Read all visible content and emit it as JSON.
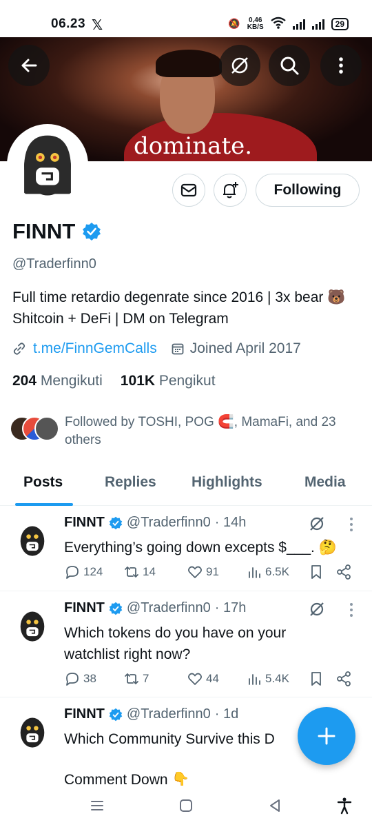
{
  "status_bar": {
    "time": "06.23",
    "app_icon": "x-logo",
    "net_speed_value": "0,46",
    "net_speed_unit": "KB/S",
    "battery": "29"
  },
  "header": {
    "banner_caption": "dominate.",
    "back_icon": "back-arrow-icon",
    "grok_icon": "grok-icon",
    "search_icon": "search-icon",
    "more_icon": "more-vertical-icon"
  },
  "profile": {
    "name": "FINNT",
    "handle": "@Traderfinn0",
    "bio": "Full time retardio degenrate since 2016 | 3x bear 🐻 Shitcoin + DeFi | DM on Telegram",
    "link": "t.me/FinnGemCalls",
    "joined": "Joined April 2017",
    "following_count": "204",
    "following_label": "Mengikuti",
    "followers_count": "101K",
    "followers_label": "Pengikut",
    "followed_by": "Followed by TOSHI, POG 🧲, MamaFi, and 23 others",
    "following_button": "Following",
    "accent": "#1d9bf0"
  },
  "tabs": [
    {
      "label": "Posts",
      "active": true
    },
    {
      "label": "Replies",
      "active": false
    },
    {
      "label": "Highlights",
      "active": false
    },
    {
      "label": "Media",
      "active": false
    }
  ],
  "tweets": [
    {
      "name": "FINNT",
      "handle": "@Traderfinn0",
      "time": "· 14h",
      "text": "Everything’s going down excepts $___. 🤔",
      "replies": "124",
      "reposts": "14",
      "likes": "91",
      "views": "6.5K"
    },
    {
      "name": "FINNT",
      "handle": "@Traderfinn0",
      "time": "· 17h",
      "text": "Which tokens do you have on your watchlist right now?",
      "replies": "38",
      "reposts": "7",
      "likes": "44",
      "views": "5.4K"
    },
    {
      "name": "FINNT",
      "handle": "@Traderfinn0",
      "time": "· 1d",
      "text": "Which Community Survive this D",
      "text2": "Comment Down 👇"
    }
  ]
}
